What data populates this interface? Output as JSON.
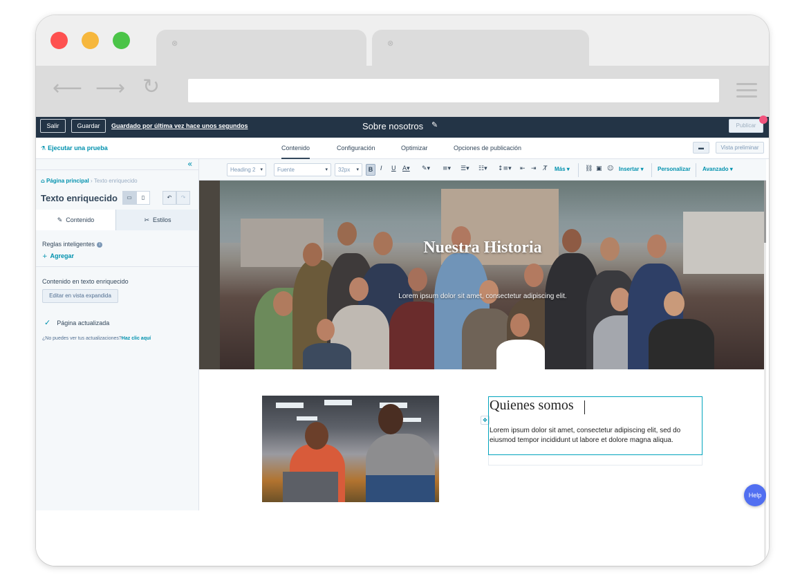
{
  "browser": {
    "dot_colors": [
      "#fe5150",
      "#f6b73d",
      "#4bc448"
    ],
    "tab_close": "⊗"
  },
  "topbar": {
    "exit_label": "Salir",
    "save_label": "Guardar",
    "saved_status": "Guardado por última vez hace unos segundos",
    "page_title": "Sobre nosotros",
    "publish_label": "Publicar"
  },
  "editor_tabs": {
    "run_test": "Ejecutar una prueba",
    "tabs": [
      "Contenido",
      "Configuración",
      "Optimizar",
      "Opciones de publicación"
    ],
    "active_tab": "Contenido",
    "preview_label": "Vista preliminar"
  },
  "sidebar": {
    "breadcrumb_home": "Página principal",
    "breadcrumb_current": "Texto enriquecido",
    "module_title": "Texto enriquecido",
    "tabs": [
      "Contenido",
      "Estilos"
    ],
    "smart_rules_label": "Reglas inteligentes",
    "add_label": "Agregar",
    "richtext_label": "Contenido en texto enriquecido",
    "expand_button": "Editar en vista expandida",
    "updated_label": "Página actualizada",
    "hint_text": "¿No puedes ver tus actualizaciones?",
    "hint_link": "Haz clic aquí"
  },
  "format_toolbar": {
    "style_select": "Heading 2",
    "font_select": "Fuente",
    "size_select": "32px",
    "insert_label": "Insertar",
    "personalize_label": "Personalizar",
    "advanced_label": "Avanzado",
    "more_label": "Más"
  },
  "canvas": {
    "hero_title": "Nuestra Historia",
    "hero_subtitle": "Lorem ipsum dolor sit amet, consectetur adipiscing elit.",
    "section_heading": "Quienes somos",
    "section_paragraph": "Lorem ipsum dolor sit amet, consectetur adipiscing elit, sed do eiusmod tempor incididunt ut labore et dolore magna aliqua.",
    "help_label": "Help"
  },
  "colors": {
    "topbar_bg": "#233446",
    "accent": "#0091ae",
    "help_bg": "#516ff1",
    "notification": "#f2547d"
  }
}
